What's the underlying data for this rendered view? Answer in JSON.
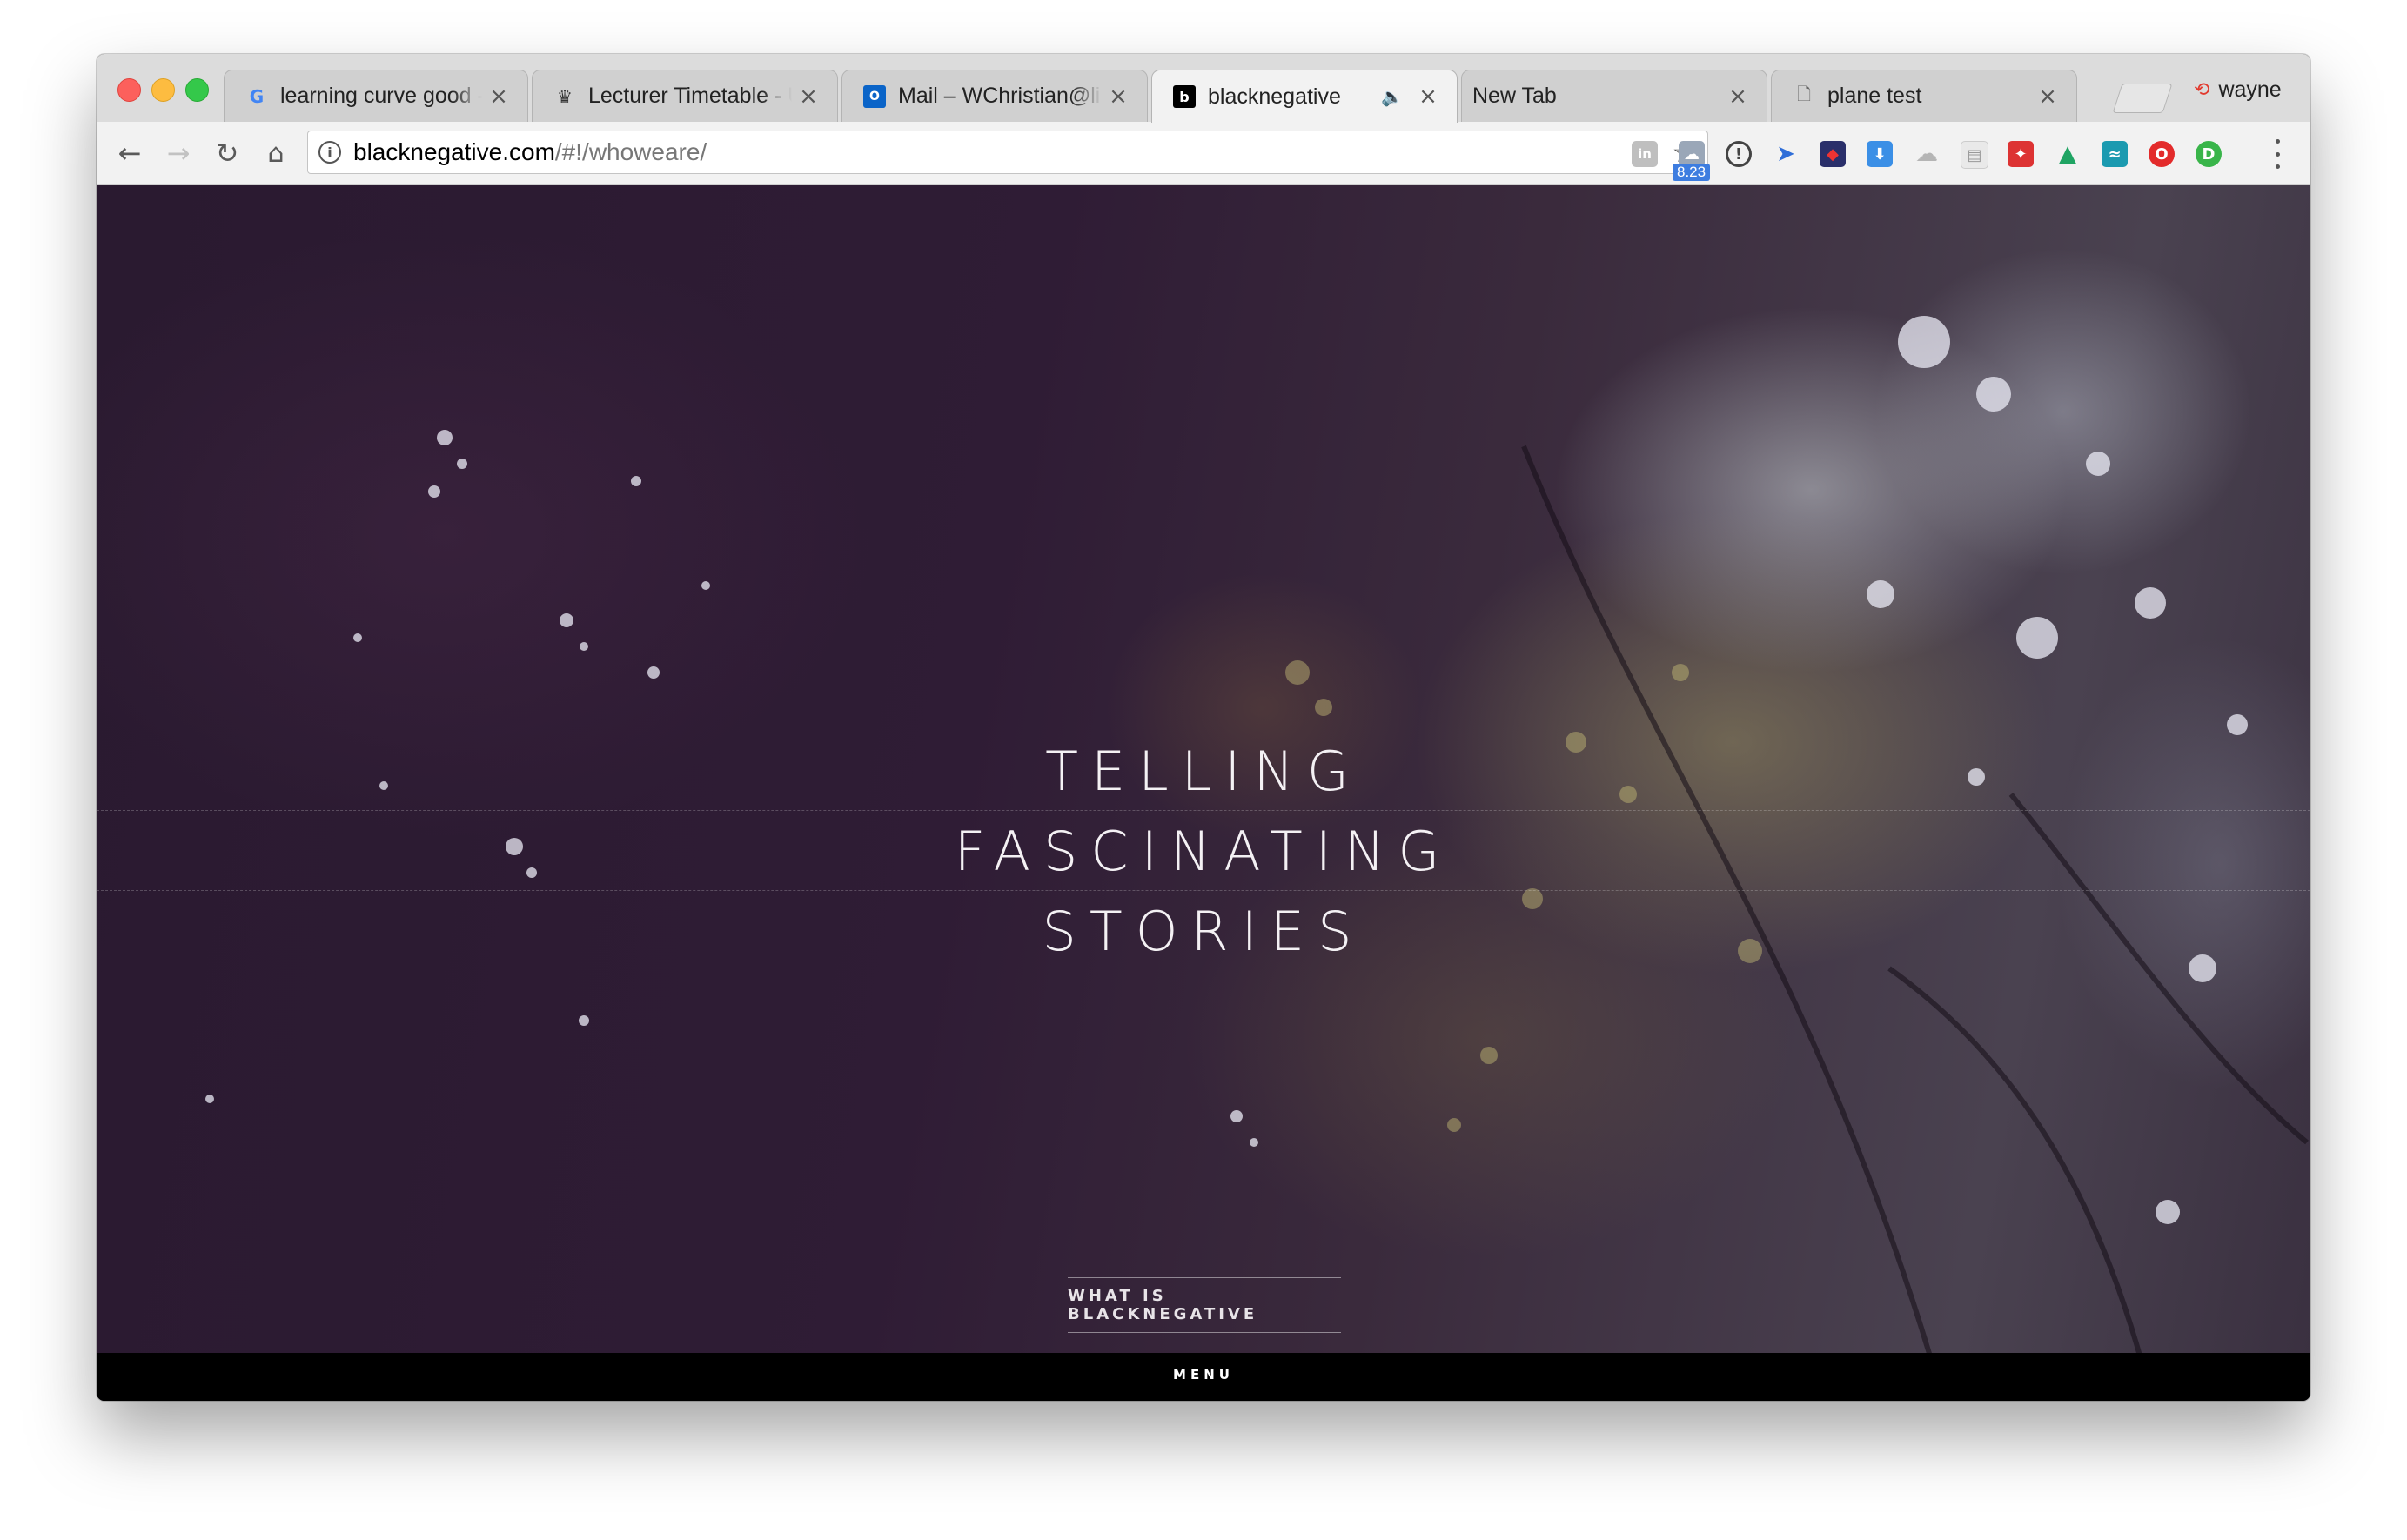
{
  "browser": {
    "tabs": [
      {
        "title": "learning curve good - ",
        "favicon": "google-g-icon",
        "active": false
      },
      {
        "title": "Lecturer Timetable - U",
        "favicon": "university-crest-icon",
        "active": false
      },
      {
        "title": "Mail – WChristian@linc",
        "favicon": "outlook-icon",
        "active": false
      },
      {
        "title": "blacknegative",
        "favicon": "blacknegative-logo-icon",
        "active": true,
        "audio": true
      },
      {
        "title": "New Tab",
        "favicon": "",
        "active": false
      },
      {
        "title": "plane test",
        "favicon": "document-icon",
        "active": false
      }
    ],
    "profile_name": "wayne",
    "url_host": "blacknegative.com",
    "url_path": "/#!/whoweare/",
    "extension_badge": "8.23",
    "extensions": [
      "linkedin-ext-icon",
      "weather-ext-icon",
      "onepassword-ext-icon",
      "bird-ext-icon",
      "app-ext-icon",
      "download-ext-icon",
      "cloud-ext-icon",
      "calendar-ext-icon",
      "shield-ext-icon",
      "drive-ext-icon",
      "wave-ext-icon",
      "opera-ext-icon",
      "green-ext-icon"
    ]
  },
  "page": {
    "hero_lines": [
      "TELLING",
      "FASCINATING",
      "STORIES"
    ],
    "cta_label": "WHAT IS BLACKNEGATIVE",
    "menu_label": "MENU"
  },
  "colors": {
    "accent_close": "#fc605c",
    "accent_minimize": "#fdbc40",
    "accent_maximize": "#34c84a",
    "page_background": "#2f1c35"
  }
}
